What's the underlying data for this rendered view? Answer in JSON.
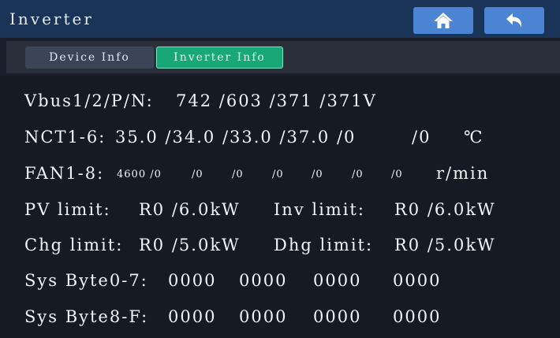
{
  "header": {
    "title": "Inverter",
    "home_icon": "home-icon",
    "back_icon": "back-arrow-icon",
    "accent": "#4a84d3"
  },
  "tabs": [
    {
      "label": "Device Info",
      "active": false
    },
    {
      "label": "Inverter Info",
      "active": true
    }
  ],
  "rows": {
    "vbus": {
      "label": "Vbus1/2/P/N:",
      "values": "742 /603 /371 /371V"
    },
    "nct": {
      "label": "NCT1-6:",
      "values": "35.0 /34.0 /33.0 /37.0 /0",
      "extra": "/0",
      "unit": "℃"
    },
    "fan": {
      "label": "FAN1-8:",
      "v1": "4600 /0",
      "v2": "/0",
      "v3": "/0",
      "v4": "/0",
      "v5": "/0",
      "v6": "/0",
      "v7": "/0",
      "unit": "r/min"
    },
    "pv_limit": {
      "label": "PV limit:",
      "value": "R0 /6.0kW"
    },
    "inv_limit": {
      "label": "Inv limit:",
      "value": "R0 /6.0kW"
    },
    "chg_limit": {
      "label": "Chg limit:",
      "value": "R0 /5.0kW"
    },
    "dhg_limit": {
      "label": "Dhg limit:",
      "value": "R0 /5.0kW"
    },
    "sys07": {
      "label": "Sys Byte0-7:",
      "b1": "0000",
      "b2": "0000",
      "b3": "0000",
      "b4": "0000"
    },
    "sys8f": {
      "label": "Sys Byte8-F:",
      "b1": "0000",
      "b2": "0000",
      "b3": "0000",
      "b4": "0000"
    }
  }
}
